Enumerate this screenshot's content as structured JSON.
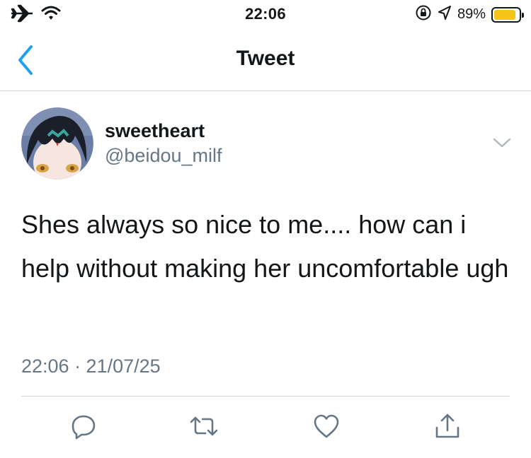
{
  "status_bar": {
    "time": "22:06",
    "battery_percent": "89%",
    "battery_level": 0.89,
    "battery_color": "#f5c518",
    "left_icons": [
      "airplane-icon",
      "wifi-icon"
    ],
    "right_icons": [
      "orientation-lock-icon",
      "location-icon"
    ]
  },
  "nav": {
    "title": "Tweet",
    "back_icon": "chevron-left-icon",
    "accent_color": "#1da1f2"
  },
  "tweet": {
    "display_name": "sweetheart",
    "handle": "@beidou_milf",
    "text": "Shes always so nice to me.... how can i help without making her uncomfortable ugh",
    "timestamp": "22:06 · 21/07/25",
    "menu_icon": "chevron-down-icon"
  },
  "actions": [
    {
      "name": "reply",
      "icon": "reply-icon"
    },
    {
      "name": "retweet",
      "icon": "retweet-icon"
    },
    {
      "name": "like",
      "icon": "heart-icon"
    },
    {
      "name": "share",
      "icon": "share-icon"
    }
  ],
  "colors": {
    "text": "#14171a",
    "secondary_text": "#657786",
    "icon": "#657786",
    "divider": "#d6d6d6"
  }
}
